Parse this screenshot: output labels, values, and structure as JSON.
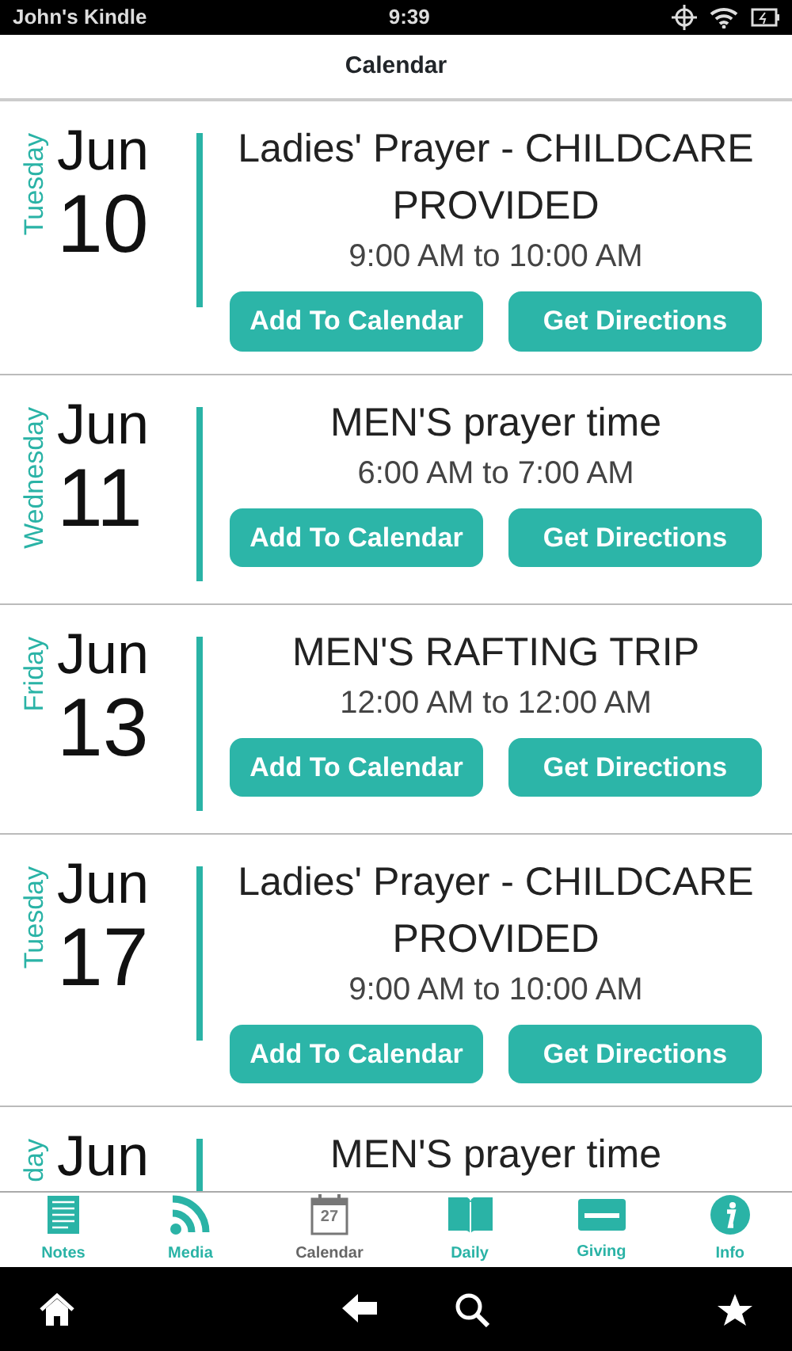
{
  "status_bar": {
    "device": "John's Kindle",
    "time": "9:39"
  },
  "header": {
    "title": "Calendar"
  },
  "events": [
    {
      "weekday": "Tuesday",
      "month": "Jun",
      "day": "10",
      "title": "Ladies' Prayer - CHILDCARE PROVIDED",
      "time": "9:00 AM to 10:00 AM",
      "buttons": [
        "Add To Calendar",
        "Get Directions"
      ]
    },
    {
      "weekday": "Wednesday",
      "month": "Jun",
      "day": "11",
      "title": "MEN'S prayer time",
      "time": "6:00 AM to 7:00 AM",
      "buttons": [
        "Add To Calendar",
        "Get Directions"
      ]
    },
    {
      "weekday": "Friday",
      "month": "Jun",
      "day": "13",
      "title": "MEN'S RAFTING TRIP",
      "time": "12:00 AM to 12:00 AM",
      "buttons": [
        "Add To Calendar",
        "Get Directions"
      ]
    },
    {
      "weekday": "Tuesday",
      "month": "Jun",
      "day": "17",
      "title": "Ladies' Prayer - CHILDCARE PROVIDED",
      "time": "9:00 AM to 10:00 AM",
      "buttons": [
        "Add To Calendar",
        "Get Directions"
      ]
    },
    {
      "weekday": "day",
      "month": "Jun",
      "title": "MEN'S prayer time"
    }
  ],
  "tab_bar": [
    {
      "kind": "notes",
      "label": "Notes",
      "selected": false
    },
    {
      "kind": "media",
      "label": "Media",
      "selected": false
    },
    {
      "kind": "calendar",
      "label": "Calendar",
      "selected": true,
      "icon_text": "27"
    },
    {
      "kind": "daily",
      "label": "Daily",
      "selected": false
    },
    {
      "kind": "giving",
      "label": "Giving",
      "selected": false
    },
    {
      "kind": "info",
      "label": "Info",
      "selected": false
    }
  ]
}
